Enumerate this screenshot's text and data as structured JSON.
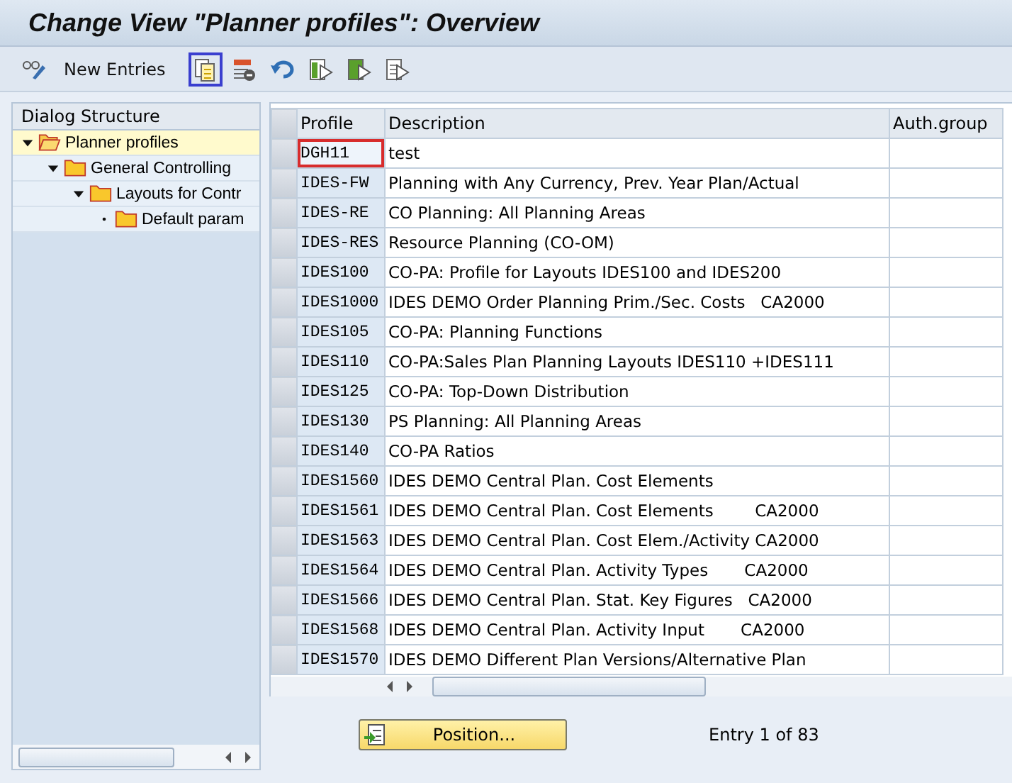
{
  "window": {
    "title": "Change View \"Planner profiles\": Overview"
  },
  "toolbar": [
    {
      "kind": "icon",
      "highlighted": false
    },
    {
      "kind": "text",
      "label": "New Entries",
      "highlighted": false
    },
    {
      "kind": "icon",
      "highlighted": true
    },
    {
      "kind": "icon",
      "highlighted": false
    },
    {
      "kind": "icon",
      "highlighted": false
    },
    {
      "kind": "icon",
      "highlighted": false
    },
    {
      "kind": "icon",
      "highlighted": false
    },
    {
      "kind": "icon",
      "highlighted": false
    }
  ],
  "dialog_structure": {
    "title": "Dialog Structure",
    "items": [
      {
        "label": "Planner profiles",
        "selected": true,
        "expanded": true,
        "children": [
          {
            "label": "General Controlling",
            "selected": false,
            "expanded": true,
            "children": [
              {
                "label": "Layouts for Contr",
                "selected": false,
                "expanded": true,
                "children": [
                  {
                    "label": "Default param",
                    "selected": false
                  }
                ]
              }
            ]
          }
        ]
      }
    ]
  },
  "table": {
    "columns": [
      "Profile",
      "Description",
      "Auth.group"
    ],
    "rows": [
      {
        "profile": "DGH11",
        "description": "test",
        "focused": true
      },
      {
        "profile": "IDES-FW",
        "description": "Planning with Any Currency, Prev. Year Plan/Actual",
        "focused": false
      },
      {
        "profile": "IDES-RE",
        "description": "CO Planning: All Planning Areas",
        "focused": false
      },
      {
        "profile": "IDES-RES",
        "description": "Resource Planning (CO-OM)",
        "focused": false
      },
      {
        "profile": "IDES100",
        "description": "CO-PA: Profile for Layouts IDES100 and IDES200",
        "focused": false
      },
      {
        "profile": "IDES1000",
        "description": "IDES DEMO Order Planning Prim./Sec. Costs   CA2000",
        "focused": false
      },
      {
        "profile": "IDES105",
        "description": "CO-PA: Planning Functions",
        "focused": false
      },
      {
        "profile": "IDES110",
        "description": "CO-PA:Sales Plan Planning Layouts IDES110 +IDES111",
        "focused": false
      },
      {
        "profile": "IDES125",
        "description": "CO-PA: Top-Down Distribution",
        "focused": false
      },
      {
        "profile": "IDES130",
        "description": "PS Planning: All Planning Areas",
        "focused": false
      },
      {
        "profile": "IDES140",
        "description": "CO-PA Ratios",
        "focused": false
      },
      {
        "profile": "IDES1560",
        "description": "IDES DEMO Central Plan. Cost Elements",
        "focused": false
      },
      {
        "profile": "IDES1561",
        "description": "IDES DEMO Central Plan. Cost Elements        CA2000",
        "focused": false
      },
      {
        "profile": "IDES1563",
        "description": "IDES DEMO Central Plan. Cost Elem./Activity CA2000",
        "focused": false
      },
      {
        "profile": "IDES1564",
        "description": "IDES DEMO Central Plan. Activity Types       CA2000",
        "focused": false
      },
      {
        "profile": "IDES1566",
        "description": "IDES DEMO Central Plan. Stat. Key Figures   CA2000",
        "focused": false
      },
      {
        "profile": "IDES1568",
        "description": "IDES DEMO Central Plan. Activity Input       CA2000",
        "focused": false
      },
      {
        "profile": "IDES1570",
        "description": "IDES DEMO Different Plan Versions/Alternative Plan",
        "focused": false
      }
    ]
  },
  "position_button": {
    "label": "Position..."
  },
  "entry_info": "Entry 1 of 83"
}
